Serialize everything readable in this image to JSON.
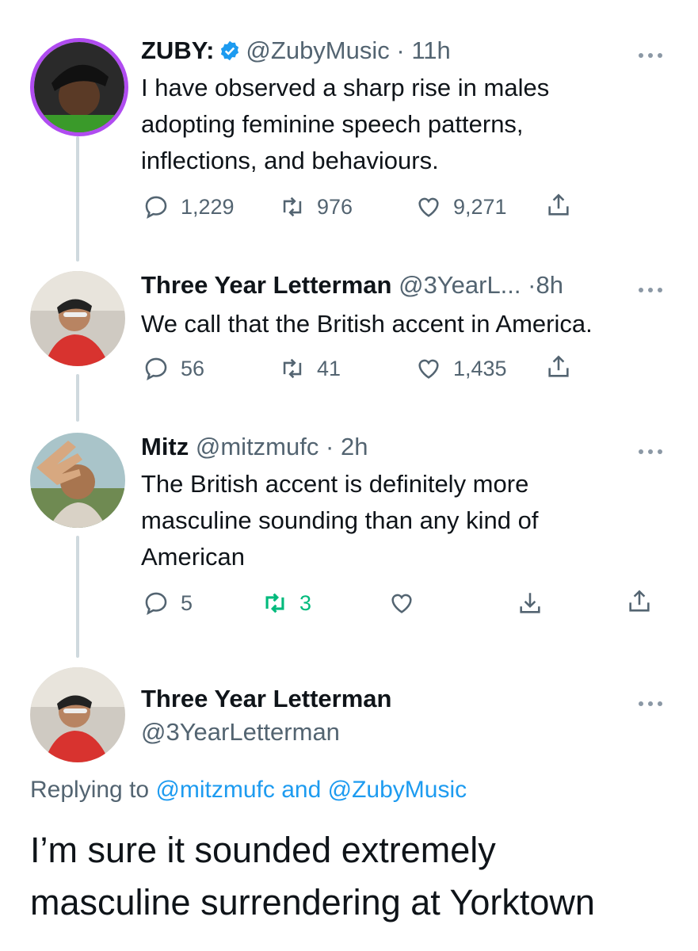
{
  "tweets": [
    {
      "name": "ZUBY:",
      "handle": "@ZubyMusic",
      "dot": "·",
      "time": "11h",
      "lines": [
        "I have observed a sharp rise in males",
        "adopting feminine speech patterns,",
        "inflections, and behaviours."
      ],
      "replies": "1,229",
      "retweets": "976",
      "likes": "9,271"
    },
    {
      "name": "Three Year Letterman",
      "handle": "@3YearL...",
      "dot": "·",
      "time": "8h",
      "lines": [
        "We call that the British accent in America."
      ],
      "replies": "56",
      "retweets": "41",
      "likes": "1,435"
    },
    {
      "name": "Mitz",
      "handle": "@mitzmufc",
      "dot": "·",
      "time": "2h",
      "lines": [
        "The British accent is definitely more",
        "masculine sounding than any kind of",
        "American"
      ],
      "replies": "5",
      "retweets": "3"
    }
  ],
  "main_tweet": {
    "name": "Three Year Letterman",
    "handle": "@3YearLetterman",
    "replying_prefix": "Replying to",
    "reply_to_1": "@mitzmufc",
    "reply_and": "and",
    "reply_to_2": "@ZubyMusic",
    "lines": [
      "I’m sure it sounded extremely",
      "masculine surrendering at Yorktown"
    ]
  },
  "colors": {
    "link": "#1d9bf0",
    "retweet_active": "#00ba7c",
    "muted": "#536471",
    "thread_line": "#cfd9de"
  },
  "icons": [
    "reply-icon",
    "retweet-icon",
    "like-icon",
    "share-icon",
    "download-icon",
    "verified-icon",
    "more-icon"
  ]
}
